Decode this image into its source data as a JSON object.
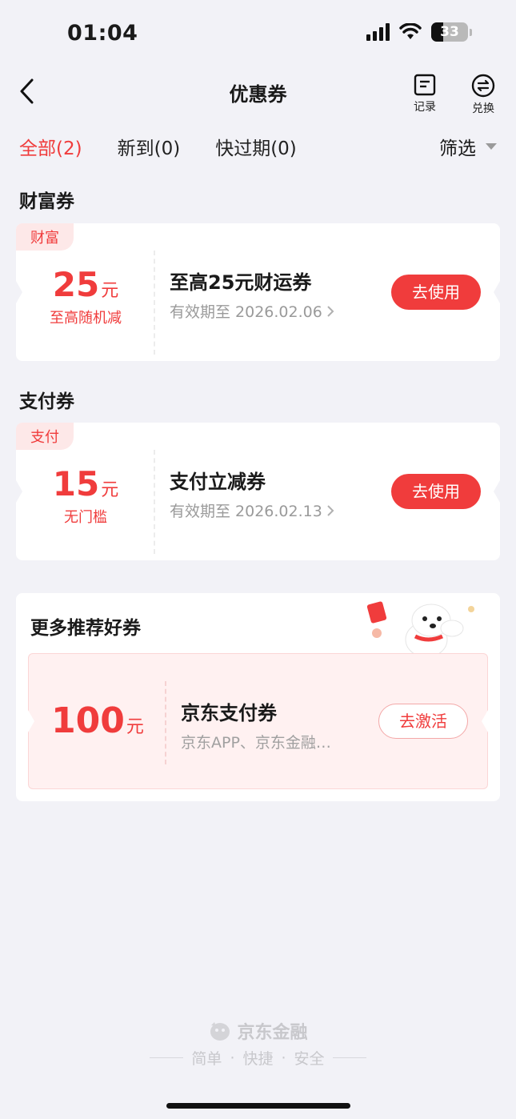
{
  "status_bar": {
    "time": "01:04",
    "battery": "33"
  },
  "nav": {
    "title": "优惠券",
    "records_label": "记录",
    "exchange_label": "兑换"
  },
  "tabs": [
    {
      "label": "全部(2)",
      "active": true
    },
    {
      "label": "新到(0)",
      "active": false
    },
    {
      "label": "快过期(0)",
      "active": false
    }
  ],
  "filter_label": "筛选",
  "sections": [
    {
      "title": "财富券",
      "coupon": {
        "tag": "财富",
        "amount": "25",
        "unit": "元",
        "condition": "至高随机减",
        "name": "至高25元财运券",
        "validity": "有效期至 2026.02.06",
        "button": "去使用"
      }
    },
    {
      "title": "支付券",
      "coupon": {
        "tag": "支付",
        "amount": "15",
        "unit": "元",
        "condition": "无门槛",
        "name": "支付立减券",
        "validity": "有效期至 2026.02.13",
        "button": "去使用"
      }
    }
  ],
  "recommend": {
    "title": "更多推荐好券",
    "coupon": {
      "amount": "100",
      "unit": "元",
      "name": "京东支付券",
      "desc": "京东APP、京东金融…",
      "button": "去激活"
    }
  },
  "footer": {
    "brand": "京东金融",
    "slogan": [
      "简单",
      "·",
      "快捷",
      "·",
      "安全"
    ]
  },
  "colors": {
    "accent": "#f03c3c",
    "background": "#f2f2f7",
    "tag_bg": "#fde8e8"
  }
}
